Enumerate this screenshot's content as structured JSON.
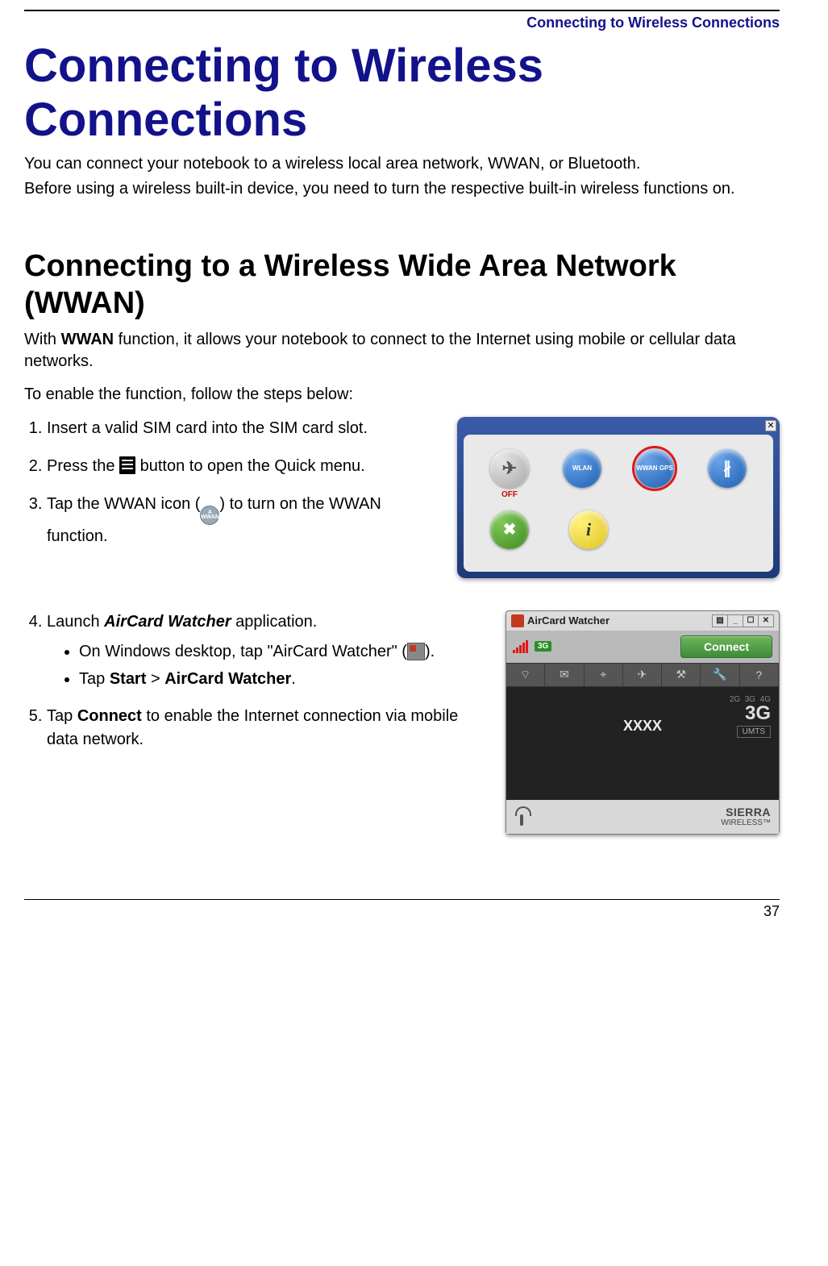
{
  "header": {
    "running_head": "Connecting to Wireless Connections"
  },
  "title": "Connecting to Wireless Connections",
  "intro": {
    "p1": "You can connect your notebook to a wireless local area network, WWAN, or Bluetooth.",
    "p2": "Before using a wireless built-in device, you need to turn the respective built-in wireless functions on."
  },
  "section": {
    "heading": "Connecting to a Wireless Wide Area Network (WWAN)",
    "lead_prefix": "With ",
    "lead_bold": "WWAN",
    "lead_suffix": " function, it allows your notebook to connect to the Internet using mobile or cellular data networks.",
    "enable_line": "To enable the function, follow the steps below:"
  },
  "steps_a": {
    "s1": "Insert a valid SIM card into the SIM card slot.",
    "s2_prefix": "Press the ",
    "s2_suffix": " button to open the Quick menu.",
    "s3_prefix": "Tap the WWAN icon (",
    "s3_suffix": ") to turn on the WWAN function."
  },
  "steps_b": {
    "s4_prefix": "Launch ",
    "s4_app": "AirCard Watcher",
    "s4_suffix": " application.",
    "b1_prefix": "On Windows desktop, tap \"AirCard Watcher\" (",
    "b1_suffix": ").",
    "b2_prefix": "Tap ",
    "b2_start": "Start",
    "b2_sep": " > ",
    "b2_app": "AirCard Watcher",
    "b2_end": ".",
    "s5_prefix": "Tap ",
    "s5_bold": "Connect",
    "s5_suffix": " to enable the Internet connection via mobile data network."
  },
  "quickmenu": {
    "items": [
      {
        "name": "airplane",
        "label": "OFF",
        "color": "gray",
        "glyph": "✈"
      },
      {
        "name": "wlan",
        "label": "",
        "color": "blue",
        "glyph": "WLAN"
      },
      {
        "name": "wwan-gps",
        "label": "",
        "color": "blue",
        "glyph": "WWAN GPS",
        "highlight": true
      },
      {
        "name": "bluetooth",
        "label": "",
        "color": "blue",
        "glyph": "B"
      },
      {
        "name": "tools",
        "label": "",
        "color": "green",
        "glyph": "✖"
      },
      {
        "name": "info",
        "label": "",
        "color": "yellow",
        "glyph": "i"
      }
    ]
  },
  "aircard": {
    "title": "AirCard Watcher",
    "status_badge": "3G",
    "connect_label": "Connect",
    "carrier": "XXXX",
    "mode_small_left": "2G",
    "mode_small_mid": "3G",
    "mode_small_right": "4G",
    "mode_big": "3G",
    "mode_sub": "UMTS",
    "brand_top": "SIERRA",
    "brand_bottom": "WIRELESS™"
  },
  "page_number": "37"
}
